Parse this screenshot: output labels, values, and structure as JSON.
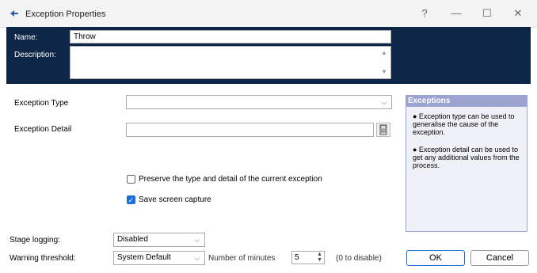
{
  "window": {
    "title": "Exception Properties"
  },
  "header": {
    "name_label": "Name:",
    "name_value": "Throw",
    "description_label": "Description:"
  },
  "form": {
    "exception_type_label": "Exception Type",
    "exception_detail_label": "Exception Detail",
    "preserve_label": "Preserve the type and detail of the current exception",
    "preserve_checked": false,
    "screen_capture_label": "Save screen capture",
    "screen_capture_checked": true
  },
  "help": {
    "title": "Exceptions",
    "bullet1": "● Exception type can be used to generalise the cause of the exception.",
    "bullet2": "● Exception detail can be used to get any additional values from the process."
  },
  "bottom": {
    "stage_logging_label": "Stage logging:",
    "stage_logging_value": "Disabled",
    "warning_threshold_label": "Warning threshold:",
    "warning_threshold_value": "System Default",
    "minutes_label": "Number of minutes",
    "minutes_value": "5",
    "disable_hint": "(0 to disable)",
    "ok_label": "OK",
    "cancel_label": "Cancel"
  },
  "colors": {
    "header_bg": "#0d2647",
    "accent": "#1a6ed8",
    "help_title_bg": "#9ba3d1"
  }
}
